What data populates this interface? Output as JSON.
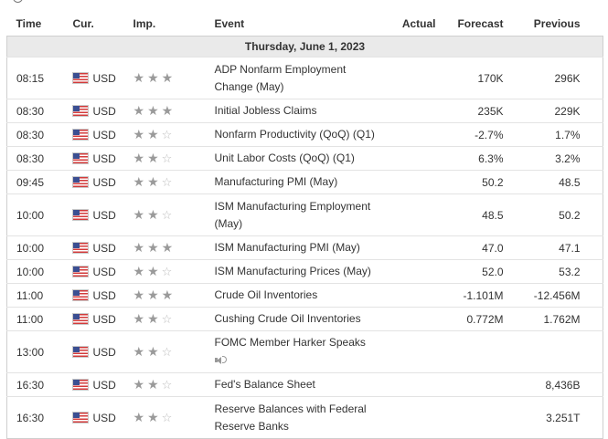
{
  "header": {
    "time": "Time",
    "currency": "Cur.",
    "importance": "Imp.",
    "event": "Event",
    "actual": "Actual",
    "forecast": "Forecast",
    "previous": "Previous"
  },
  "day_label": "Thursday, June 1, 2023",
  "colors": {
    "flag_red": "#d23a3a",
    "flag_blue": "#3b4f92",
    "star": "#9a9a9a",
    "day_bg": "#eaeaea"
  },
  "rows": [
    {
      "time": "08:15",
      "currency": "USD",
      "stars": 3,
      "event": "ADP Nonfarm Employment Change (May)",
      "actual": "",
      "forecast": "170K",
      "previous": "296K"
    },
    {
      "time": "08:30",
      "currency": "USD",
      "stars": 3,
      "event": "Initial Jobless Claims",
      "actual": "",
      "forecast": "235K",
      "previous": "229K"
    },
    {
      "time": "08:30",
      "currency": "USD",
      "stars": 2,
      "event": "Nonfarm Productivity (QoQ) (Q1)",
      "actual": "",
      "forecast": "-2.7%",
      "previous": "1.7%"
    },
    {
      "time": "08:30",
      "currency": "USD",
      "stars": 2,
      "event": "Unit Labor Costs (QoQ) (Q1)",
      "actual": "",
      "forecast": "6.3%",
      "previous": "3.2%"
    },
    {
      "time": "09:45",
      "currency": "USD",
      "stars": 2,
      "event": "Manufacturing PMI (May)",
      "actual": "",
      "forecast": "50.2",
      "previous": "48.5"
    },
    {
      "time": "10:00",
      "currency": "USD",
      "stars": 2,
      "event": "ISM Manufacturing Employment (May)",
      "actual": "",
      "forecast": "48.5",
      "previous": "50.2"
    },
    {
      "time": "10:00",
      "currency": "USD",
      "stars": 3,
      "event": "ISM Manufacturing PMI (May)",
      "actual": "",
      "forecast": "47.0",
      "previous": "47.1"
    },
    {
      "time": "10:00",
      "currency": "USD",
      "stars": 2,
      "event": "ISM Manufacturing Prices (May)",
      "actual": "",
      "forecast": "52.0",
      "previous": "53.2"
    },
    {
      "time": "11:00",
      "currency": "USD",
      "stars": 3,
      "event": "Crude Oil Inventories",
      "actual": "",
      "forecast": "-1.101M",
      "previous": "-12.456M"
    },
    {
      "time": "11:00",
      "currency": "USD",
      "stars": 2,
      "event": "Cushing Crude Oil Inventories",
      "actual": "",
      "forecast": "0.772M",
      "previous": "1.762M"
    },
    {
      "time": "13:00",
      "currency": "USD",
      "stars": 2,
      "event": "FOMC Member Harker Speaks",
      "speech_icon": "speaker-icon",
      "actual": "",
      "forecast": "",
      "previous": ""
    },
    {
      "time": "16:30",
      "currency": "USD",
      "stars": 2,
      "event": "Fed's Balance Sheet",
      "actual": "",
      "forecast": "",
      "previous": "8,436B"
    },
    {
      "time": "16:30",
      "currency": "USD",
      "stars": 2,
      "event": "Reserve Balances with Federal Reserve Banks",
      "actual": "",
      "forecast": "",
      "previous": "3.251T"
    }
  ]
}
